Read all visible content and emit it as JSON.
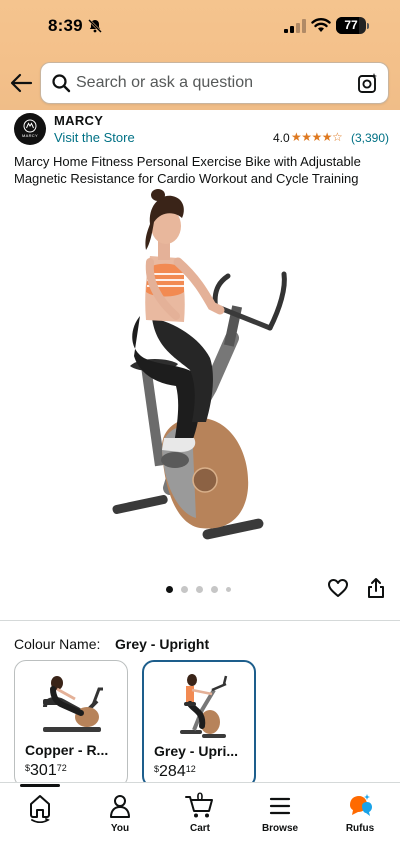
{
  "status_bar": {
    "time": "8:39",
    "battery": "77",
    "icons": [
      "bell-off-icon",
      "signal-icon",
      "wifi-icon",
      "battery-icon"
    ]
  },
  "search": {
    "placeholder": "Search or ask a question",
    "value": ""
  },
  "brand": {
    "name": "MARCY",
    "logo_text": "MARCY",
    "visit_store": "Visit the Store",
    "rating": "4.0",
    "stars": "★★★★☆",
    "rating_count": "(3,390)"
  },
  "product": {
    "title": "Marcy Home Fitness Personal Exercise Bike with Adjustable Magnetic Resistance for Cardio Workout and Cycle Training",
    "image_count": 5,
    "active_image": 1
  },
  "colour": {
    "label": "Colour Name:",
    "selected": "Grey - Upright",
    "variants": [
      {
        "name": "Copper - R...",
        "currency": "$",
        "price_whole": "301",
        "price_fraction": "72",
        "selected": false
      },
      {
        "name": "Grey - Upri...",
        "currency": "$",
        "price_whole": "284",
        "price_fraction": "12",
        "selected": true
      }
    ]
  },
  "bottom_nav": {
    "items": [
      {
        "label": "",
        "icon": "home-icon"
      },
      {
        "label": "You",
        "icon": "person-icon"
      },
      {
        "label": "Cart",
        "icon": "cart-icon",
        "count": "0"
      },
      {
        "label": "Browse",
        "icon": "menu-icon"
      },
      {
        "label": "Rufus",
        "icon": "rufus-icon"
      }
    ]
  },
  "colors": {
    "header": "#f3c08a",
    "link": "#007185",
    "star": "#de7921",
    "selected_border": "#1d5e8c"
  }
}
